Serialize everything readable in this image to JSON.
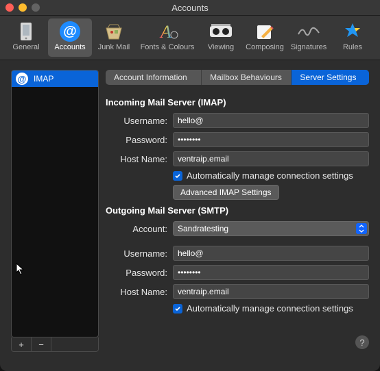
{
  "window": {
    "title": "Accounts"
  },
  "toolbar": {
    "items": [
      {
        "label": "General"
      },
      {
        "label": "Accounts"
      },
      {
        "label": "Junk Mail"
      },
      {
        "label": "Fonts & Colours"
      },
      {
        "label": "Viewing"
      },
      {
        "label": "Composing"
      },
      {
        "label": "Signatures"
      },
      {
        "label": "Rules"
      }
    ]
  },
  "sidebar": {
    "accounts": [
      {
        "label": "IMAP"
      }
    ],
    "add": "+",
    "remove": "−"
  },
  "tabs": [
    {
      "label": "Account Information"
    },
    {
      "label": "Mailbox Behaviours"
    },
    {
      "label": "Server Settings"
    }
  ],
  "incoming": {
    "title": "Incoming Mail Server (IMAP)",
    "labels": {
      "username": "Username:",
      "password": "Password:",
      "host": "Host Name:"
    },
    "username": "hello@",
    "password": "••••••••",
    "host": "ventraip.email",
    "auto_label": "Automatically manage connection settings",
    "advanced_btn": "Advanced IMAP Settings"
  },
  "outgoing": {
    "title": "Outgoing Mail Server (SMTP)",
    "account_label": "Account:",
    "account_value": "Sandratesting",
    "labels": {
      "username": "Username:",
      "password": "Password:",
      "host": "Host Name:"
    },
    "username": "hello@",
    "password": "••••••••",
    "host": "ventraip.email",
    "auto_label": "Automatically manage connection settings"
  },
  "help": "?"
}
